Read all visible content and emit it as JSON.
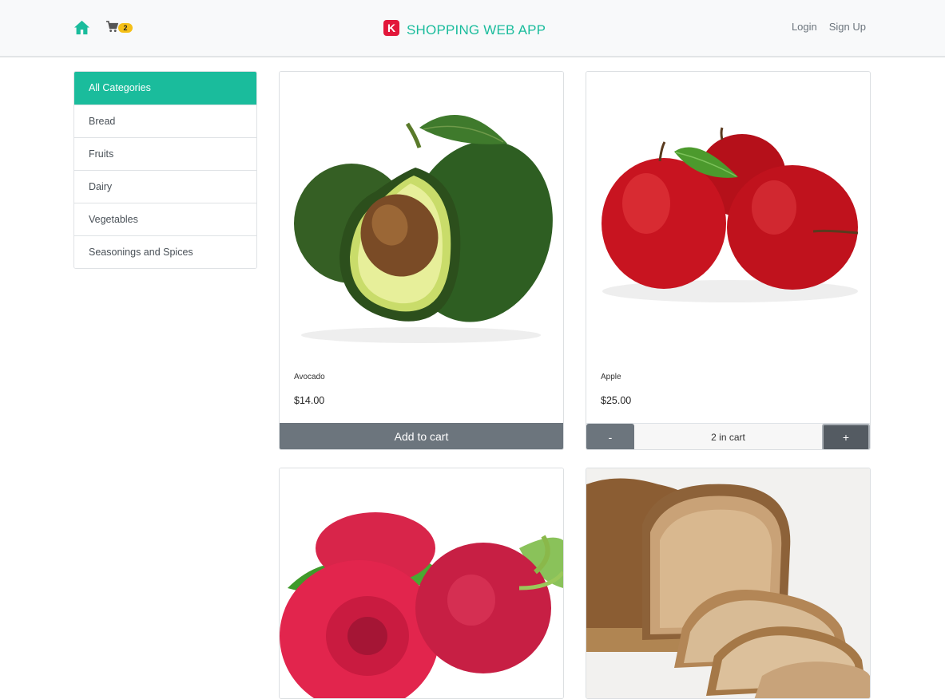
{
  "navbar": {
    "home_icon": "home-icon",
    "cart_icon": "shopping-cart-icon",
    "cart_count": "2",
    "brand_logo_letter": "K",
    "brand_title": "SHOPPING WEB APP",
    "login_label": "Login",
    "signup_label": "Sign Up",
    "accent_color": "#1abc9c",
    "logo_color": "#e2173a",
    "badge_color": "#f5c017"
  },
  "sidebar": {
    "categories": [
      {
        "label": "All Categories",
        "active": true
      },
      {
        "label": "Bread"
      },
      {
        "label": "Fruits"
      },
      {
        "label": "Dairy"
      },
      {
        "label": "Vegetables"
      },
      {
        "label": "Seasonings and Spices"
      }
    ]
  },
  "products": [
    {
      "name": "Avocado",
      "price": "$14.00",
      "image": "avocado",
      "button_label": "Add to cart"
    },
    {
      "name": "Apple",
      "price": "$25.00",
      "image": "apple",
      "minus_label": "-",
      "plus_label": "+",
      "cart_qty_text": "2 in cart"
    },
    {
      "image": "raspberry"
    },
    {
      "image": "bread"
    }
  ]
}
